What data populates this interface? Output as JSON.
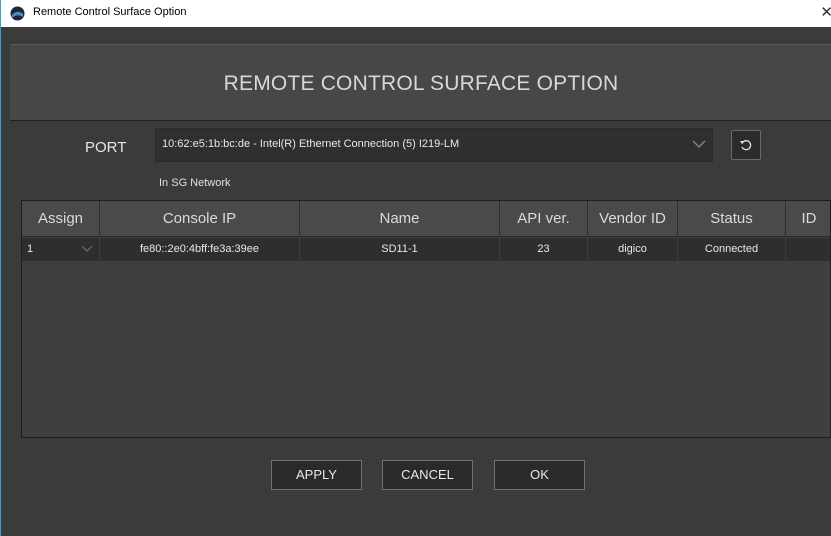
{
  "window": {
    "title": "Remote Control Surface Option",
    "heading": "REMOTE CONTROL SURFACE OPTION"
  },
  "port": {
    "label": "PORT",
    "selected": "10:62:e5:1b:bc:de - Intel(R) Ethernet Connection (5) I219-LM",
    "network_note": "In SG Network"
  },
  "table": {
    "columns": [
      "Assign",
      "Console IP",
      "Name",
      "API ver.",
      "Vendor ID",
      "Status",
      "ID"
    ],
    "rows": [
      {
        "assign": "1",
        "console_ip": "fe80::2e0:4bff:fe3a:39ee",
        "name": "SD11-1",
        "api_ver": "23",
        "vendor_id": "digico",
        "status": "Connected",
        "id": ""
      }
    ]
  },
  "buttons": {
    "apply": "APPLY",
    "cancel": "CANCEL",
    "ok": "OK"
  },
  "icons": {
    "app": "app-icon",
    "close": "close-icon",
    "refresh": "refresh-icon",
    "dropdown": "chevron-down-icon"
  },
  "colors": {
    "window_bg": "#3b3b3b",
    "header_bg": "#474747",
    "row_selected": "#2e2e2e",
    "accent_border": "#3aa0d8"
  }
}
